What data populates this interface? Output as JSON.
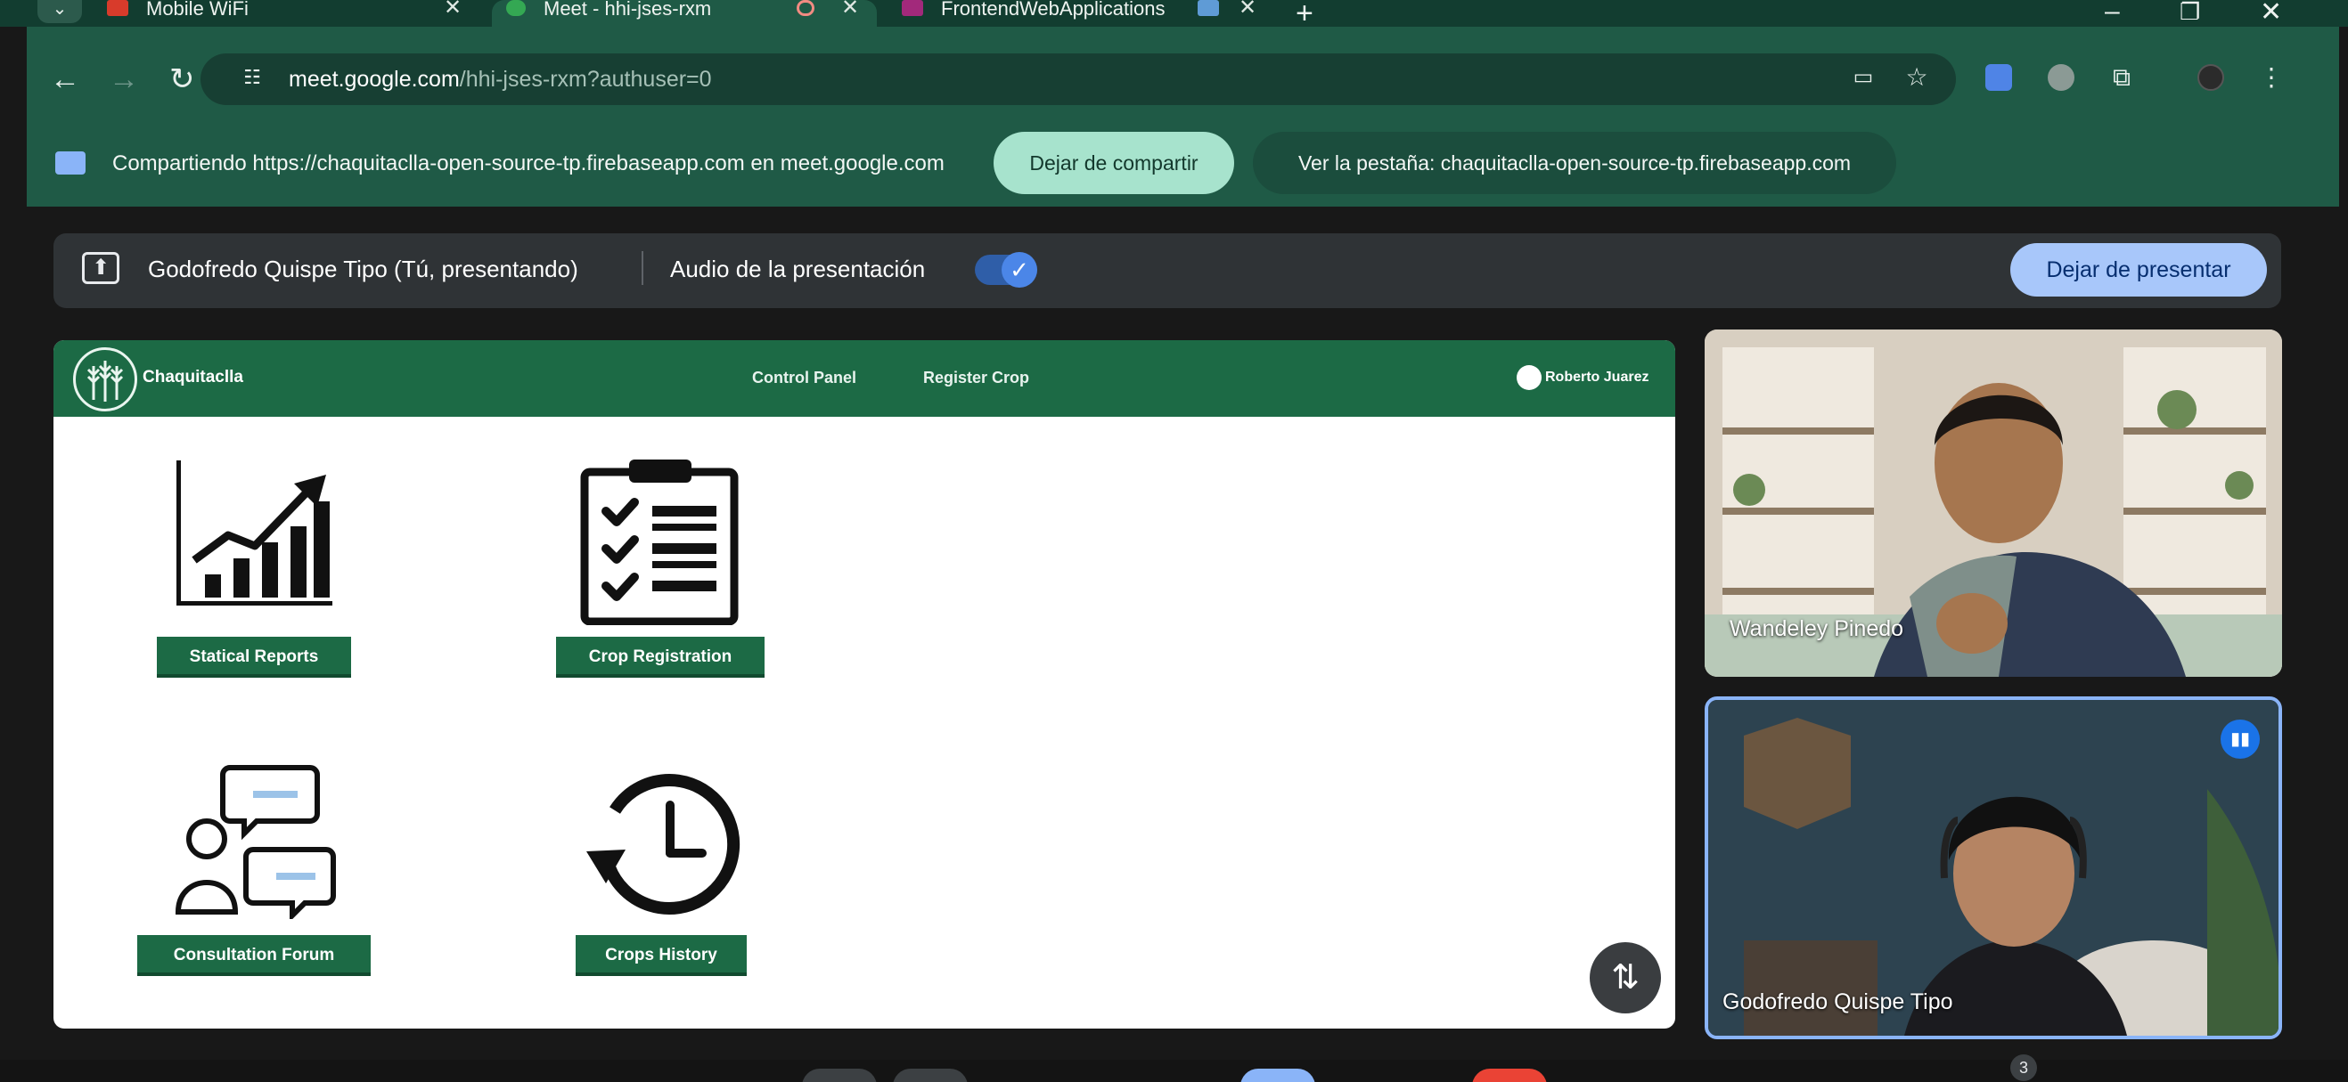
{
  "browser": {
    "tabs": [
      {
        "title": "Mobile WiFi",
        "close": "✕"
      },
      {
        "title": "Meet - hhi-jses-rxm",
        "close": "✕"
      },
      {
        "title": "FrontendWebApplications",
        "close": "✕"
      }
    ],
    "new_tab": "+",
    "url_host": "meet.google.com",
    "url_rest": "/hhi-jses-rxm?authuser=0"
  },
  "share_banner": {
    "text": "Compartiendo https://chaquitaclla-open-source-tp.firebaseapp.com en meet.google.com",
    "stop_button": "Dejar de compartir",
    "view_tab_button": "Ver la pestaña: chaquitaclla-open-source-tp.firebaseapp.com"
  },
  "meet": {
    "presenter_label": "Godofredo Quispe Tipo (Tú, presentando)",
    "audio_label": "Audio de la presentación",
    "audio_enabled": true,
    "stop_presenting": "Dejar de presentar",
    "participants": [
      {
        "name": "Wandeley Pinedo"
      },
      {
        "name": "Godofredo Quispe Tipo"
      }
    ],
    "participant_count": "3"
  },
  "shared_app": {
    "brand": "Chaquitaclla",
    "nav": [
      "Control Panel",
      "Register Crop"
    ],
    "user": "Roberto Juarez",
    "tiles": [
      {
        "label": "Statical Reports",
        "icon": "chart-growth-icon"
      },
      {
        "label": "Crop Registration",
        "icon": "clipboard-checklist-icon"
      },
      {
        "label": "Consultation Forum",
        "icon": "forum-chat-icon"
      },
      {
        "label": "Crops History",
        "icon": "history-clock-icon"
      }
    ]
  },
  "colors": {
    "chrome_dark": "#123d30",
    "chrome": "#1f5a46",
    "app_green": "#1c6a45",
    "meet_blue": "#a8c7fa"
  }
}
